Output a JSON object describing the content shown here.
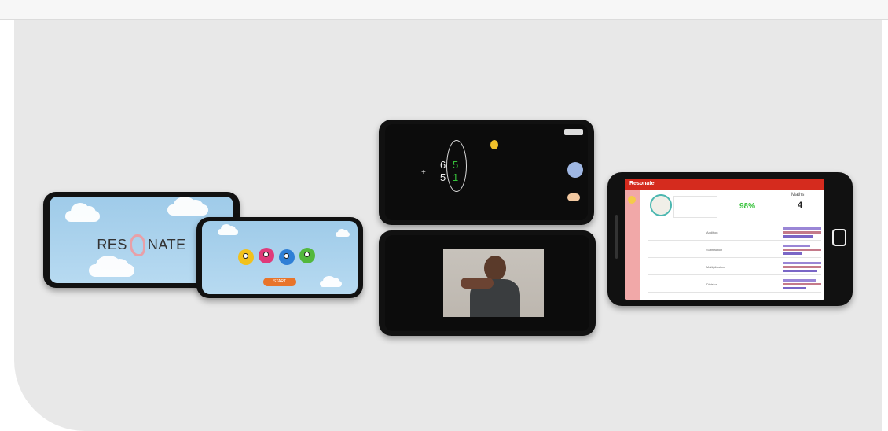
{
  "phone1": {
    "logo_left": "RES",
    "logo_right": "NATE"
  },
  "phone2": {
    "start_label": "START"
  },
  "phone3": {
    "digit_top_left": "6",
    "digit_top_right": "5",
    "digit_bottom_left": "5",
    "digit_bottom_right": "1",
    "operator": "+"
  },
  "tablet": {
    "header": "Resonate",
    "stat_percent": "98%",
    "stat_label": "Maths",
    "stat_value": "4",
    "rows": [
      {
        "label": "Addition"
      },
      {
        "label": "Subtraction"
      },
      {
        "label": "Multiplication"
      },
      {
        "label": "Division"
      }
    ]
  },
  "colors": {
    "accent_red": "#d52b1e",
    "accent_green": "#36c23a",
    "accent_orange": "#e8742a",
    "bar_purple": "#9a86d6"
  }
}
